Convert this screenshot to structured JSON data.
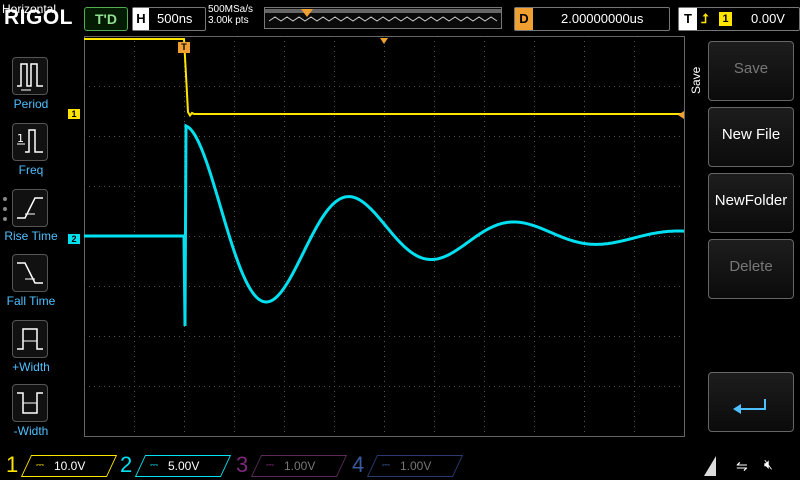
{
  "brand": "RIGOL",
  "status": "T'D",
  "horizontal": {
    "key": "H",
    "timebase": "500ns",
    "sample_rate": "500MSa/s",
    "points": "3.00k pts"
  },
  "delay": {
    "key": "D",
    "value": "2.00000000us"
  },
  "trigger": {
    "key": "T",
    "edge_symbol": "⮥",
    "source": "1",
    "level": "0.00V"
  },
  "left_menu": {
    "title": "Horizontal",
    "items": [
      {
        "label": "Period",
        "icon": "period-icon"
      },
      {
        "label": "Freq",
        "icon": "freq-icon"
      },
      {
        "label": "Rise Time",
        "icon": "rise-time-icon"
      },
      {
        "label": "Fall Time",
        "icon": "fall-time-icon"
      },
      {
        "label": "+Width",
        "icon": "pos-width-icon"
      },
      {
        "label": "-Width",
        "icon": "neg-width-icon"
      }
    ]
  },
  "right_menu": {
    "title": "Save",
    "buttons": [
      {
        "label": "Save",
        "enabled": false
      },
      {
        "label": "New File",
        "enabled": true
      },
      {
        "label": "NewFolder",
        "enabled": true
      },
      {
        "label": "Delete",
        "enabled": false
      },
      {
        "label": "",
        "icon": "return-arrow-icon",
        "enabled": true
      }
    ]
  },
  "channels": [
    {
      "num": "1",
      "scale": "10.0V",
      "color": "#ffe400",
      "active": true
    },
    {
      "num": "2",
      "scale": "5.00V",
      "color": "#00e0f0",
      "active": true
    },
    {
      "num": "3",
      "scale": "1.00V",
      "color": "#c040c0",
      "active": false
    },
    {
      "num": "4",
      "scale": "1.00V",
      "color": "#3060e0",
      "active": false
    }
  ],
  "markers": {
    "ch1": "1",
    "ch2": "2",
    "trigger_pos": "T"
  },
  "colors": {
    "ch1": "#ffe400",
    "ch2": "#00e0f0",
    "grid": "#555555",
    "trigger": "#f0a030",
    "menu_label": "#4fc0ff"
  }
}
